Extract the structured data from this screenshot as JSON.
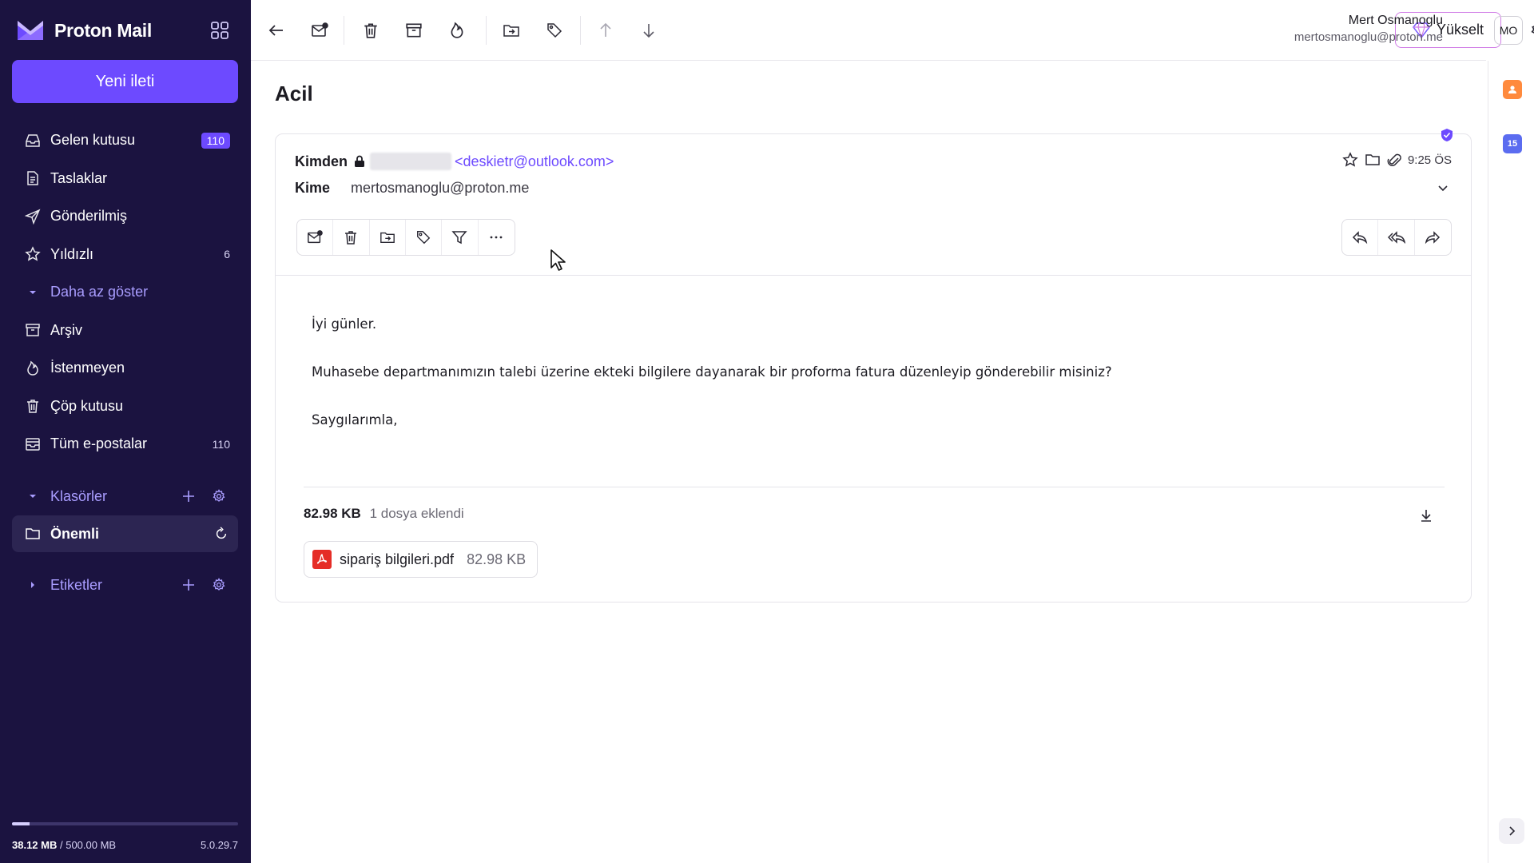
{
  "brand": {
    "name": "Proton Mail"
  },
  "compose": {
    "label": "Yeni ileti"
  },
  "nav": {
    "inbox": {
      "label": "Gelen kutusu",
      "count": "110"
    },
    "drafts": {
      "label": "Taslaklar"
    },
    "sent": {
      "label": "Gönderilmiş"
    },
    "starred": {
      "label": "Yıldızlı",
      "count": "6"
    },
    "show_less": {
      "label": "Daha az göster"
    },
    "archive": {
      "label": "Arşiv"
    },
    "spam": {
      "label": "İstenmeyen"
    },
    "trash": {
      "label": "Çöp kutusu"
    },
    "all_mail": {
      "label": "Tüm e-postalar",
      "count": "110"
    }
  },
  "folders": {
    "label": "Klasörler",
    "active_folder": "Önemli"
  },
  "labels": {
    "label": "Etiketler"
  },
  "storage": {
    "used": "38.12 MB",
    "total": "/ 500.00 MB",
    "fraction": 0.076,
    "version": "5.0.29.7"
  },
  "topbar": {
    "upgrade_label": "Yükselt"
  },
  "user": {
    "name": "Mert Osmanoglu",
    "email": "mertosmanoglu@proton.me",
    "initials": "MO"
  },
  "rail": {
    "calendar_day": "15"
  },
  "message": {
    "subject": "Acil",
    "from_label": "Kimden",
    "from_email": "<deskietr@outlook.com>",
    "to_label": "Kime",
    "to_email": "mertosmanoglu@proton.me",
    "time": "9:25 ÖS",
    "body": [
      "İyi günler.",
      "Muhasebe departmanımızın talebi üzerine ekteki bilgilere dayanarak bir proforma fatura düzenleyip gönderebilir misiniz?",
      "Saygılarımla,"
    ],
    "attachments": {
      "total_size": "82.98 KB",
      "summary": "1 dosya eklendi",
      "files": [
        {
          "name": "sipariş bilgileri.pdf",
          "size": "82.98 KB"
        }
      ]
    }
  },
  "colors": {
    "sidebar_bg": "#1b1340",
    "accent": "#6d4aff",
    "link": "#6d4aff",
    "pdf": "#e52d27",
    "notification_dot": "#ff8a00"
  }
}
